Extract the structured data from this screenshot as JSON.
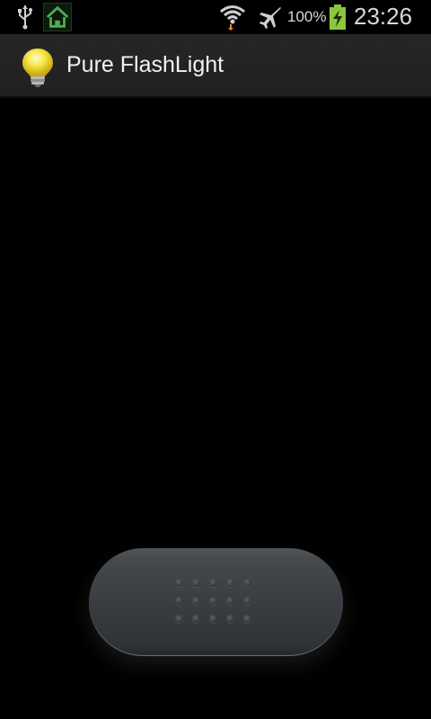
{
  "status_bar": {
    "battery_percent": "100%",
    "clock": "23:26",
    "icons": [
      "usb-icon",
      "home-notification-icon",
      "wifi-icon",
      "airplane-mode-icon",
      "battery-charging-icon"
    ]
  },
  "action_bar": {
    "title": "Pure FlashLight",
    "icon": "lightbulb-icon"
  },
  "toggle": {
    "icon": "grip-dots-icon",
    "state": "off"
  },
  "colors": {
    "background": "#000000",
    "action_bar": "#232323",
    "bulb": "#f7e84a",
    "battery": "#8cc63f"
  }
}
